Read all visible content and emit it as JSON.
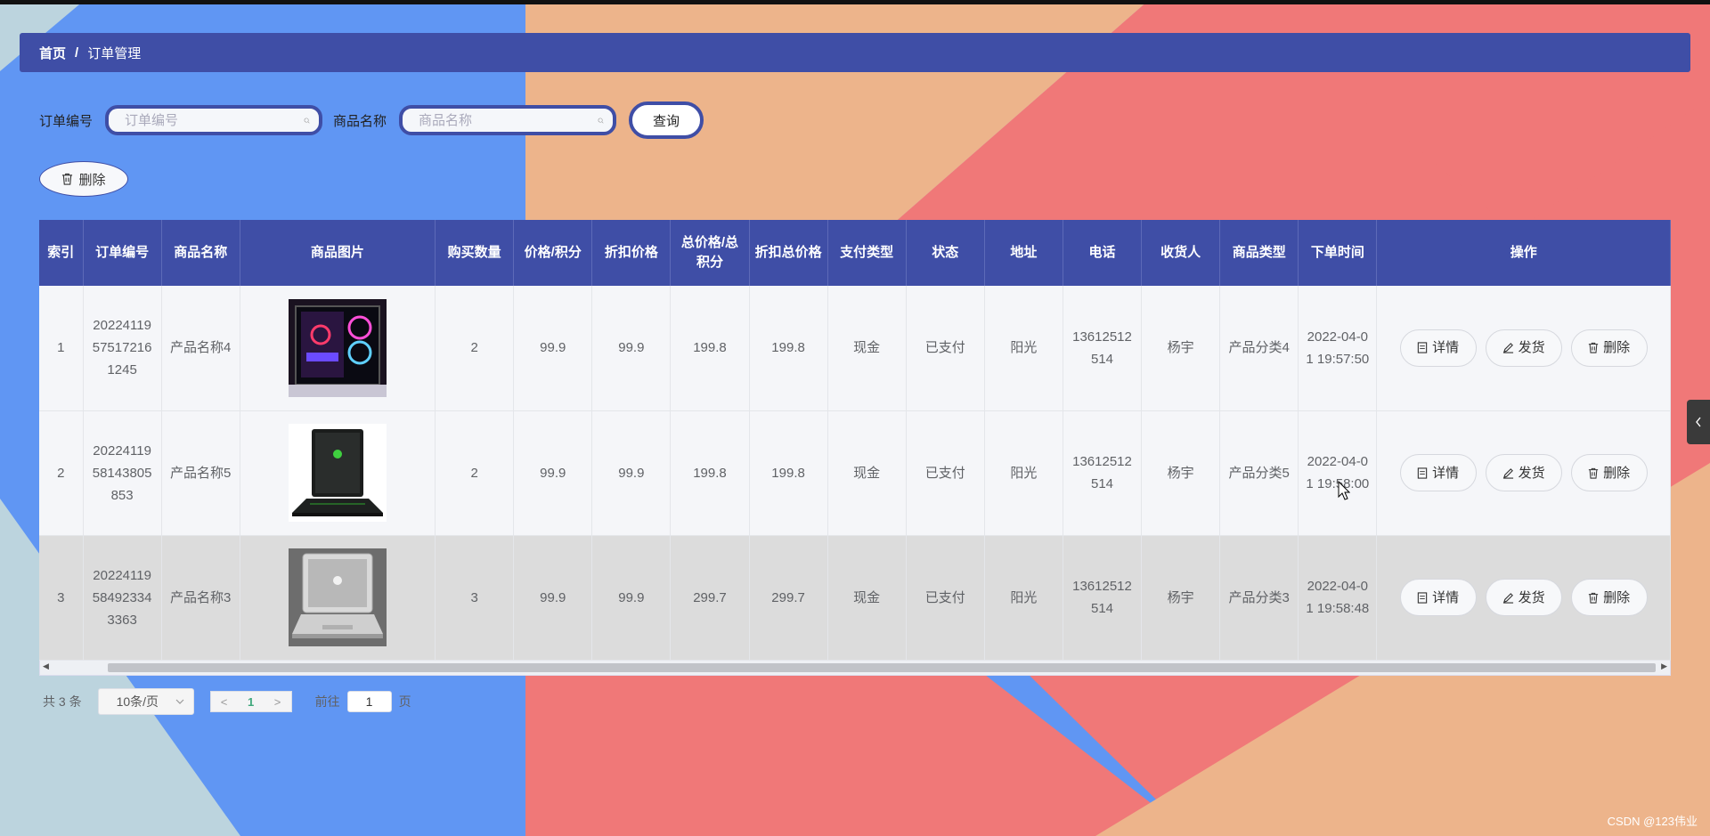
{
  "colors": {
    "accent": "#3f4ea6",
    "bg_blue": "#6096f3",
    "bg_peach": "#edb48b",
    "bg_red": "#f07878",
    "bg_gray": "#bcd4de"
  },
  "breadcrumb": {
    "home": "首页",
    "sep": "/",
    "current": "订单管理"
  },
  "search": {
    "order_label": "订单编号",
    "order_placeholder": "订单编号",
    "product_label": "商品名称",
    "product_placeholder": "商品名称",
    "query_label": "查询"
  },
  "toolbar": {
    "delete_label": "删除",
    "delete_icon": "trash-icon"
  },
  "table": {
    "headers": [
      "索引",
      "订单编号",
      "商品名称",
      "商品图片",
      "购买数量",
      "价格/积分",
      "折扣价格",
      "总价格/总积分",
      "折扣总价格",
      "支付类型",
      "状态",
      "地址",
      "电话",
      "收货人",
      "商品类型",
      "下单时间",
      "操作"
    ],
    "actions": {
      "detail": "详情",
      "ship": "发货",
      "delete": "删除"
    },
    "rows": [
      {
        "index": "1",
        "order_no": "20224119575172161245",
        "product": "产品名称4",
        "image": "gaming-pc-case-image",
        "qty": "2",
        "price": "99.9",
        "discount_price": "99.9",
        "total": "199.8",
        "discount_total": "199.8",
        "pay_type": "现金",
        "status": "已支付",
        "address": "阳光",
        "phone": "13612512514",
        "receiver": "杨宇",
        "category": "产品分类4",
        "time": "2022-04-01 19:57:50"
      },
      {
        "index": "2",
        "order_no": "2022411958143805853",
        "product": "产品名称5",
        "image": "gaming-laptop-image",
        "qty": "2",
        "price": "99.9",
        "discount_price": "99.9",
        "total": "199.8",
        "discount_total": "199.8",
        "pay_type": "现金",
        "status": "已支付",
        "address": "阳光",
        "phone": "13612512514",
        "receiver": "杨宇",
        "category": "产品分类5",
        "time": "2022-04-01 19:58:00"
      },
      {
        "index": "3",
        "order_no": "20224119584923343363",
        "product": "产品名称3",
        "image": "macbook-image",
        "qty": "3",
        "price": "99.9",
        "discount_price": "99.9",
        "total": "299.7",
        "discount_total": "299.7",
        "pay_type": "现金",
        "status": "已支付",
        "address": "阳光",
        "phone": "13612512514",
        "receiver": "杨宇",
        "category": "产品分类3",
        "time": "2022-04-01 19:58:48"
      }
    ]
  },
  "pager": {
    "total": "共 3 条",
    "size": "10条/页",
    "current": "1",
    "goto_label": "前往",
    "goto_value": "1",
    "page_label": "页"
  },
  "watermark": "CSDN @123伟业"
}
